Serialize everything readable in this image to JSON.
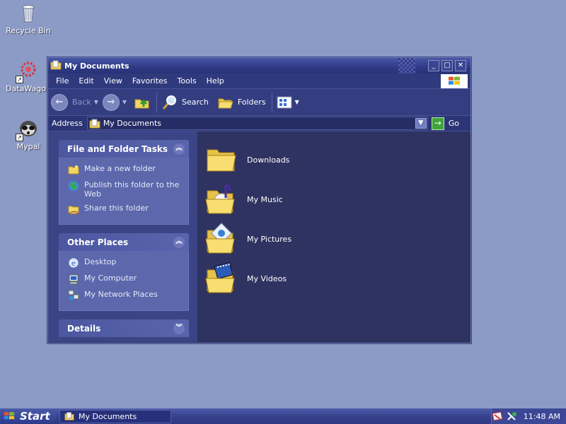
{
  "desktop": {
    "icons": [
      {
        "label": "Recycle Bin"
      },
      {
        "label": "DataWagon"
      },
      {
        "label": "Mypal"
      }
    ]
  },
  "window": {
    "title": "My Documents",
    "menu": [
      "File",
      "Edit",
      "View",
      "Favorites",
      "Tools",
      "Help"
    ],
    "toolbar": {
      "back": "Back",
      "search": "Search",
      "folders": "Folders"
    },
    "address": {
      "label": "Address",
      "value": "My Documents",
      "go": "Go"
    },
    "panels": {
      "file_tasks": {
        "title": "File and Folder Tasks",
        "items": [
          "Make a new folder",
          "Publish this folder to the Web",
          "Share this folder"
        ]
      },
      "other_places": {
        "title": "Other Places",
        "items": [
          "Desktop",
          "My Computer",
          "My Network Places"
        ]
      },
      "details": {
        "title": "Details"
      }
    },
    "folders": [
      {
        "name": "Downloads",
        "icon": "folder-icon"
      },
      {
        "name": "My Music",
        "icon": "music-folder-icon"
      },
      {
        "name": "My Pictures",
        "icon": "pictures-folder-icon"
      },
      {
        "name": "My Videos",
        "icon": "videos-folder-icon"
      }
    ]
  },
  "taskbar": {
    "start": "Start",
    "task_button": "My Documents",
    "clock": "11:48 AM"
  },
  "colors": {
    "desktop": "#8c9bc6",
    "window_bg": "#2f3361",
    "panel_body": "#5c68ab",
    "go_green": "#3fa43a"
  }
}
